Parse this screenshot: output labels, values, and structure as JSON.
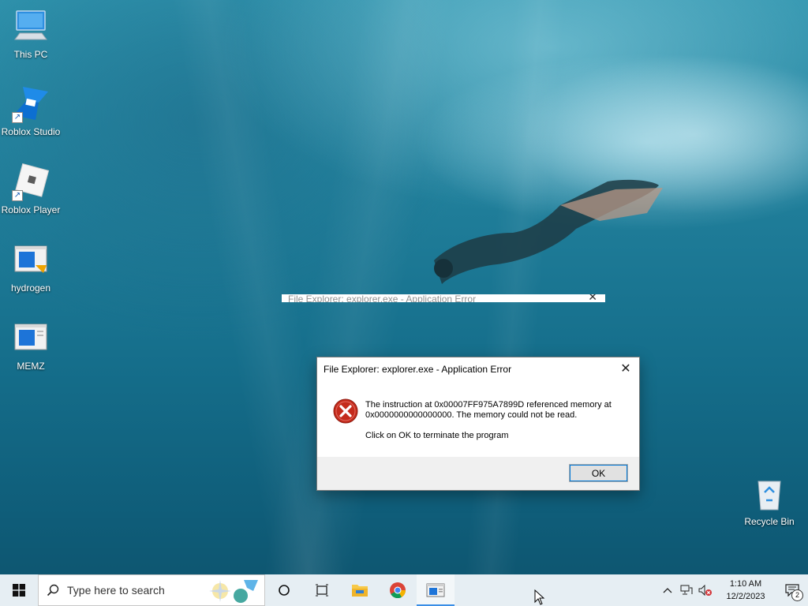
{
  "desktop": {
    "icons": [
      {
        "label": "This PC",
        "icon": "computer-icon"
      },
      {
        "label": "Roblox Studio",
        "icon": "roblox-studio-icon"
      },
      {
        "label": "Roblox Player",
        "icon": "roblox-player-icon"
      },
      {
        "label": "hydrogen",
        "icon": "application-icon"
      },
      {
        "label": "MEMZ",
        "icon": "application-icon"
      },
      {
        "label": "Recycle Bin",
        "icon": "recycle-bin-icon"
      }
    ]
  },
  "dialog": {
    "title": "File Explorer: explorer.exe - Application Error",
    "message_line1": "The instruction at 0x00007FF975A7899D referenced memory at",
    "message_line2": "0x0000000000000000. The memory could not be read.",
    "message_action": "Click on OK to terminate the program",
    "ok_label": "OK",
    "close_label": "✕",
    "icon": "error-icon"
  },
  "taskbar": {
    "search_placeholder": "Type here to search",
    "clock_time": "1:10 AM",
    "clock_date": "12/2/2023",
    "notification_count": "2",
    "apps": [
      "cortana-icon",
      "task-view-icon",
      "file-explorer-icon",
      "chrome-icon",
      "app-window-icon"
    ]
  },
  "colors": {
    "taskbar_bg": "#e6eef3",
    "accent": "#0078d7",
    "error_red": "#c42b1c"
  }
}
